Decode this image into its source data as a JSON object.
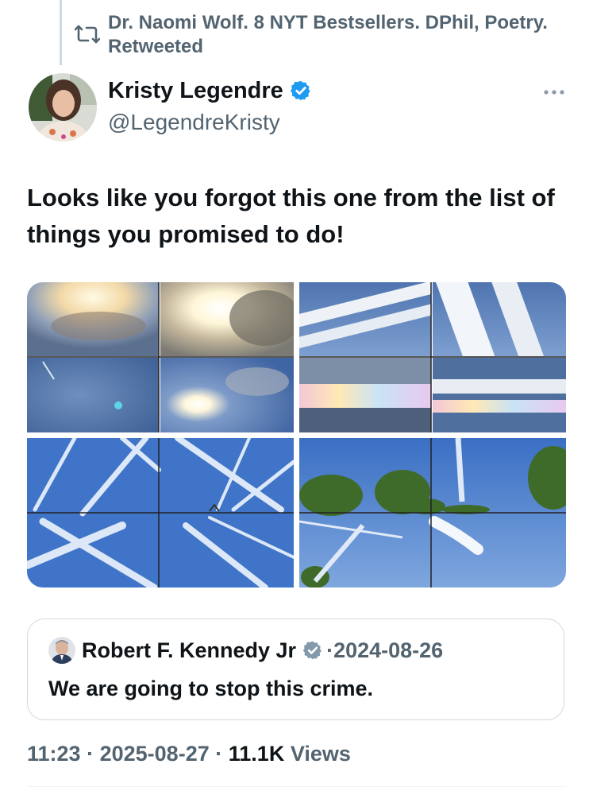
{
  "retweet": {
    "text": "Dr. Naomi Wolf. 8 NYT Bestsellers. DPhil, Poetry. Retweeted",
    "icon": "retweet-icon"
  },
  "author": {
    "name": "Kristy Legendre",
    "handle": "@LegendreKristy",
    "verified": true,
    "badge_color": "#1d9bf0"
  },
  "tweet": {
    "text": "Looks like you forgot this one from the list of things you promised to do!"
  },
  "media": {
    "image_count": 4,
    "grid": "2x2 collage, each a 2x2 sky photo grid"
  },
  "quote": {
    "name": "Robert F. Kennedy Jr",
    "separator": "·",
    "date": "2024-08-26",
    "text": "We are going to stop this crime.",
    "badge_color": "#829aab"
  },
  "meta": {
    "time": "11:23",
    "sep1": "·",
    "date": "2025-08-27",
    "sep2": "·",
    "views_count": "11.1K",
    "views_label": "Views"
  },
  "colors": {
    "text_primary": "#0f1419",
    "text_secondary": "#536471",
    "accent": "#1d9bf0",
    "border": "#cfd9de"
  }
}
